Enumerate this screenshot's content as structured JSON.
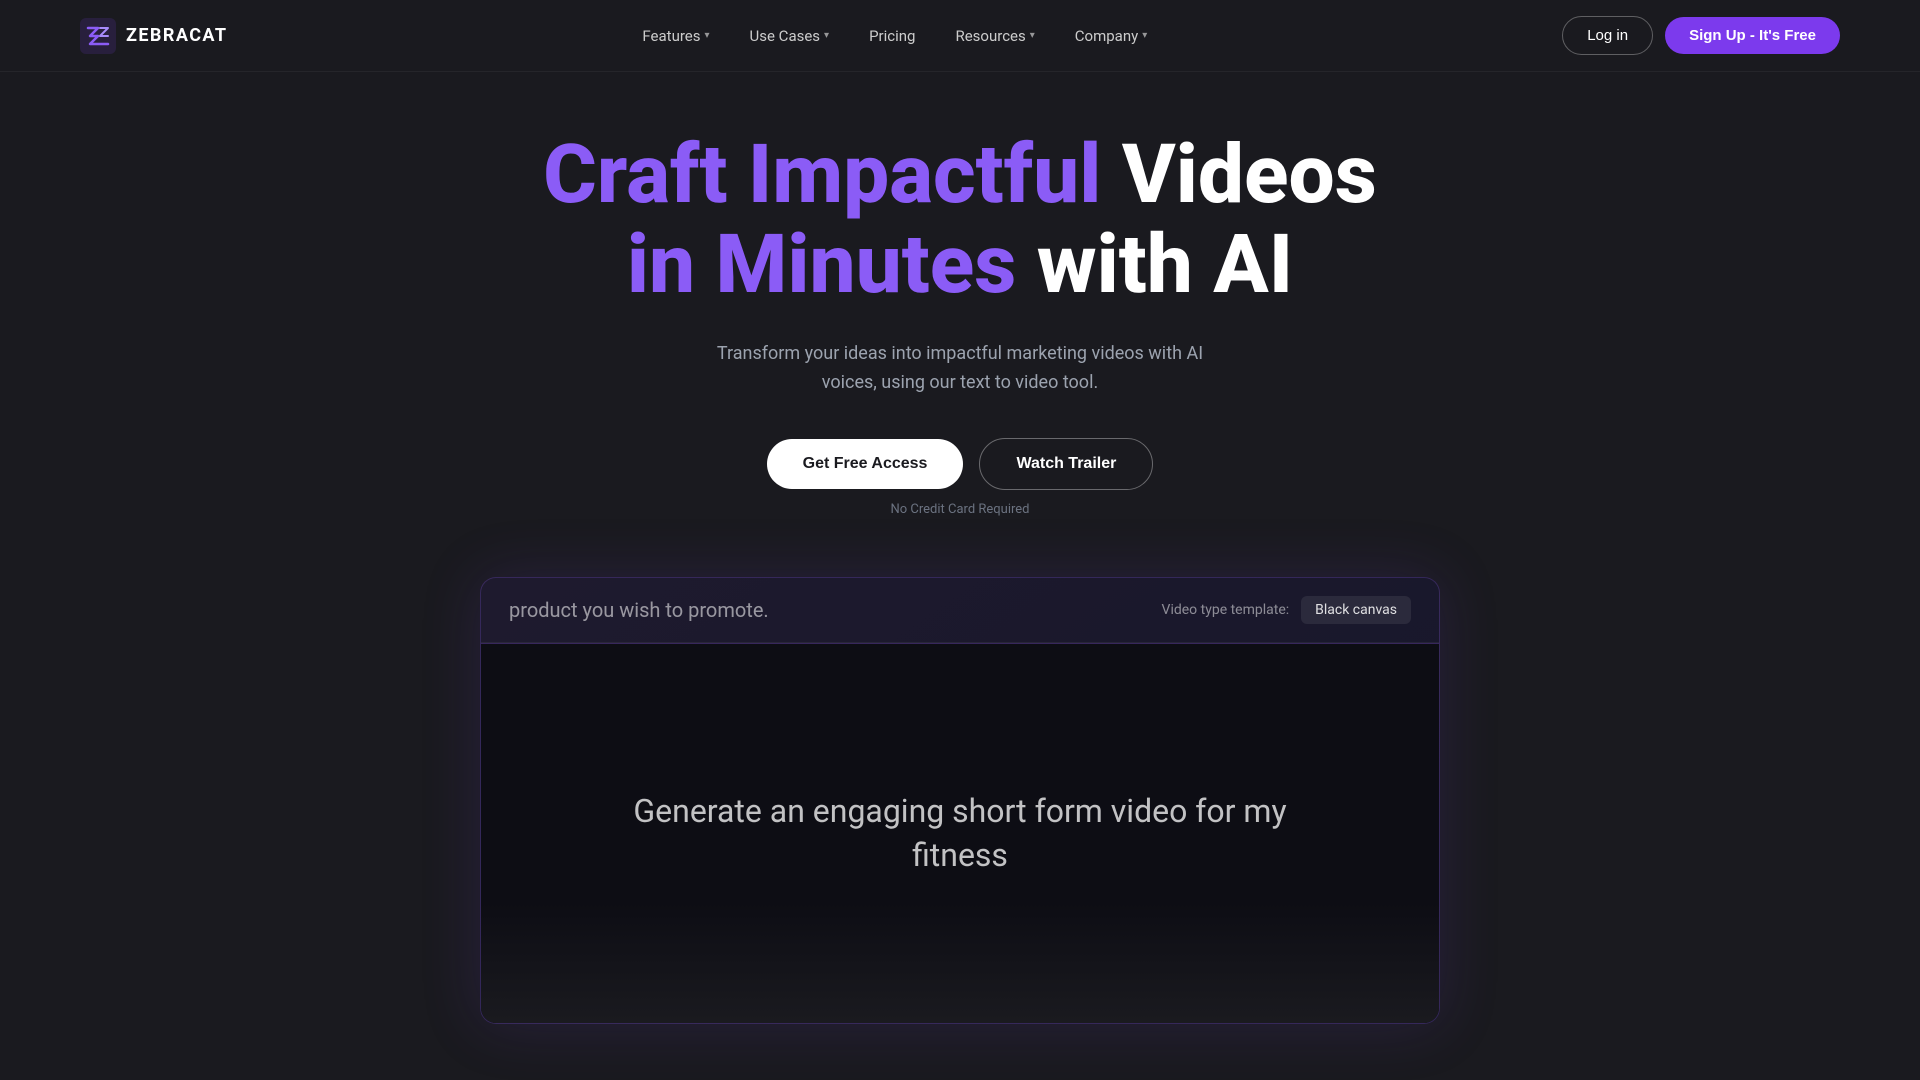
{
  "brand": {
    "name": "ZEBRACAT",
    "logo_alt": "Zebracat logo"
  },
  "navbar": {
    "features_label": "Features",
    "use_cases_label": "Use Cases",
    "pricing_label": "Pricing",
    "resources_label": "Resources",
    "company_label": "Company",
    "login_label": "Log in",
    "signup_label": "Sign Up - It's Free"
  },
  "hero": {
    "title_line1_part1": "Craft Impactful",
    "title_line1_part2": "Videos",
    "title_line2_part1": "in Minutes",
    "title_line2_part2": "with AI",
    "subtitle": "Transform your ideas into impactful marketing videos with AI voices, using our text to video tool.",
    "cta_primary": "Get Free Access",
    "cta_secondary": "Watch Trailer",
    "no_credit_card": "No Credit Card Required"
  },
  "demo": {
    "prompt_text": "product you wish to promote.",
    "template_label": "Video type template:",
    "template_value": "Black canvas",
    "video_text": "Generate an engaging short form video for my fitness"
  },
  "colors": {
    "purple": "#8b5cf6",
    "bg_dark": "#1a1a1f",
    "signup_bg": "#7c3aed"
  }
}
